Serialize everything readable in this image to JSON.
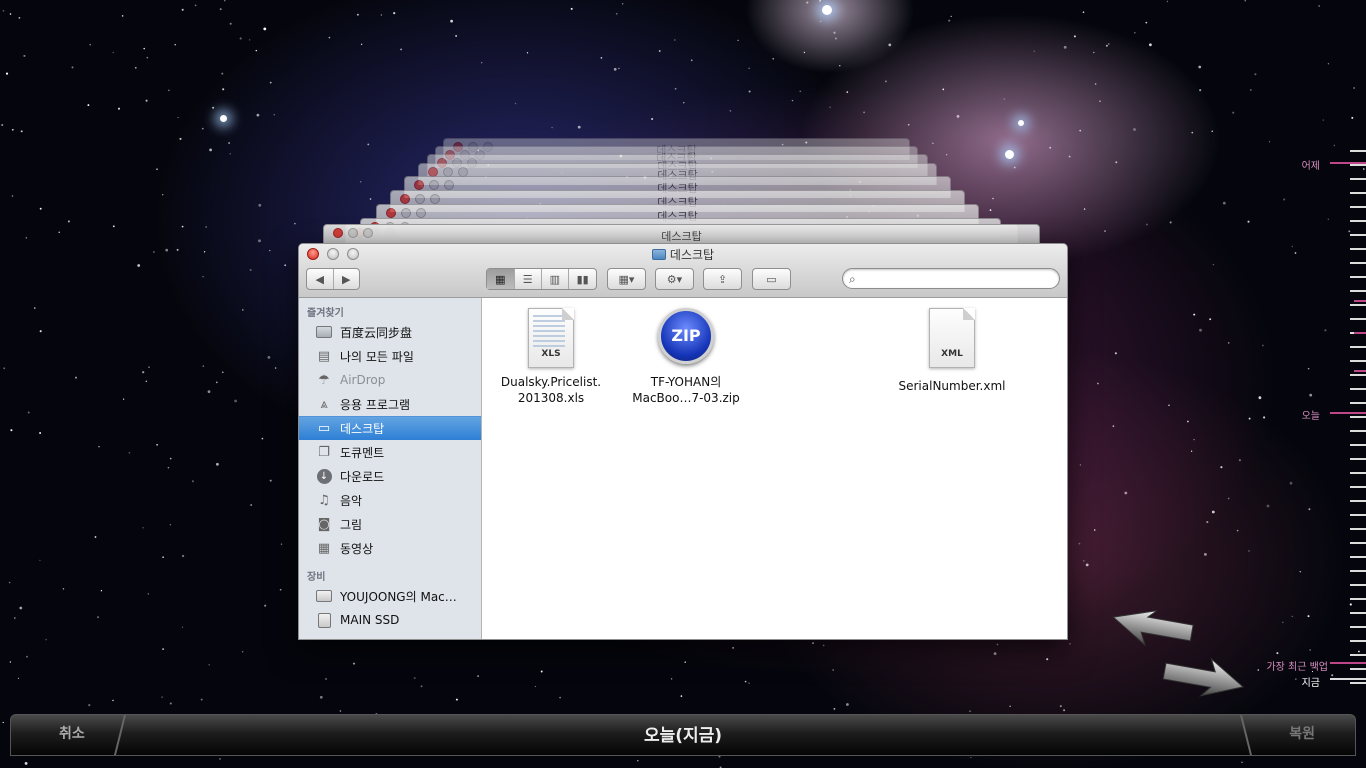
{
  "window": {
    "title": "데스크탑",
    "back_titles": [
      "데스크탑",
      "데스크탑",
      "데스크탑",
      "데스크탑",
      "데스크탑",
      "데스크탑",
      "데스크탑",
      "데스크탑"
    ]
  },
  "toolbar": {
    "back": "◀",
    "forward": "▶",
    "search_placeholder": ""
  },
  "sidebar": {
    "favorites_header": "즐겨찾기",
    "devices_header": "장비",
    "favorites": [
      {
        "label": "百度云同步盘",
        "icon": "folder-icon"
      },
      {
        "label": "나의 모든 파일",
        "icon": "all-files-icon"
      },
      {
        "label": "AirDrop",
        "icon": "airdrop-icon"
      },
      {
        "label": "응용 프로그램",
        "icon": "applications-icon"
      },
      {
        "label": "데스크탑",
        "icon": "desktop-icon"
      },
      {
        "label": "도큐멘트",
        "icon": "documents-icon"
      },
      {
        "label": "다운로드",
        "icon": "downloads-icon"
      },
      {
        "label": "음악",
        "icon": "music-icon"
      },
      {
        "label": "그림",
        "icon": "pictures-icon"
      },
      {
        "label": "동영상",
        "icon": "movies-icon"
      }
    ],
    "devices": [
      {
        "label": "YOUJOONG의 Mac…",
        "icon": "laptop-icon"
      },
      {
        "label": "MAIN SSD",
        "icon": "disk-icon"
      }
    ]
  },
  "files": [
    {
      "name_line1": "Dualsky.Pricelist.",
      "name_line2": "201308.xls",
      "type": "XLS",
      "icon": "xls-file-icon"
    },
    {
      "name_line1": "TF-YOHAN의",
      "name_line2": "MacBoo…7-03.zip",
      "type": "ZIP",
      "icon": "zip-archive-icon"
    },
    {
      "name_line1": "SerialNumber.xml",
      "name_line2": "",
      "type": "XML",
      "icon": "xml-file-icon"
    }
  ],
  "timeline": {
    "yesterday": "어제",
    "today": "오늘",
    "latest_backup": "가장 최근 백업",
    "now": "지금"
  },
  "bottom": {
    "cancel": "취소",
    "current": "오늘(지금)",
    "restore": "복원"
  },
  "colors": {
    "timeline_accent": "#c0468a",
    "selection": "#2d7fd5"
  }
}
